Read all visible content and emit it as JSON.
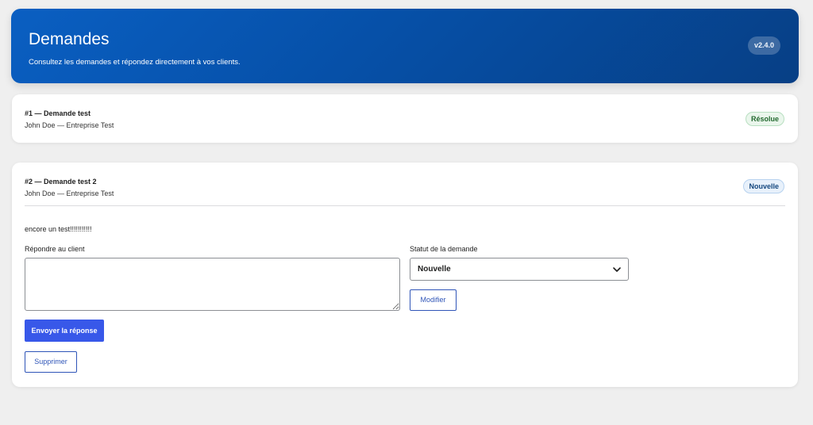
{
  "header": {
    "title": "Demandes",
    "subtitle": "Consultez les demandes et répondez directement à vos clients.",
    "version": "v2.4.0"
  },
  "requests": [
    {
      "title": "#1 — Demande test",
      "meta": "John Doe — Entreprise Test",
      "status": "Résolue"
    },
    {
      "title": "#2 — Demande test 2",
      "meta": "John Doe — Entreprise Test",
      "status": "Nouvelle",
      "message": "encore un test!!!!!!!!!!!",
      "reply_label": "Répondre au client",
      "reply_value": "",
      "status_label": "Statut de la demande",
      "status_selected": "Nouvelle",
      "modify_label": "Modifier",
      "send_label": "Envoyer la réponse",
      "delete_label": "Supprimer"
    }
  ],
  "icons": {
    "select_arrow": "chevron-down-icon"
  },
  "colors": {
    "header_gradient_start": "#0a5fc2",
    "header_gradient_end": "#073f85",
    "primary_button": "#3858e9",
    "resolved_badge_text": "#23692f",
    "new_badge_text": "#14477e"
  }
}
